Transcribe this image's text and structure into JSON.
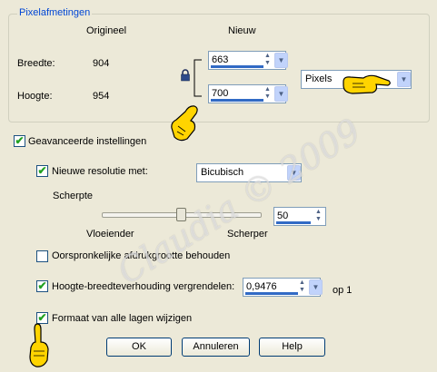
{
  "pixel_dimensions": {
    "title": "Pixelafmetingen",
    "col_original": "Origineel",
    "col_new": "Nieuw",
    "width_label": "Breedte:",
    "width_original": "904",
    "width_new": "663",
    "height_label": "Hoogte:",
    "height_original": "954",
    "height_new": "700",
    "unit": "Pixels"
  },
  "advanced": {
    "label": "Geavanceerde instellingen",
    "resample_label": "Nieuwe resolutie met:",
    "resample_method": "Bicubisch",
    "sharpness_label": "Scherpte",
    "softer_label": "Vloeiender",
    "sharper_label": "Scherper",
    "sharpness_value": "50",
    "sharpness_level": 0.5,
    "keep_print_label": "Oorspronkelijke afdrukgrootte behouden",
    "lock_ratio_label": "Hoogte-breedteverhouding vergrendelen:",
    "ratio_value": "0,9476",
    "ratio_suffix": "op 1",
    "all_layers_label": "Formaat van alle lagen wijzigen"
  },
  "buttons": {
    "ok": "OK",
    "cancel": "Annuleren",
    "help": "Help"
  },
  "watermark": "Claudia © 2009",
  "colors": {
    "dialog_bg": "#ece9d8",
    "group_title": "#0046d5",
    "check_mark": "#21a121",
    "pointer_hand": "#ffd400"
  }
}
